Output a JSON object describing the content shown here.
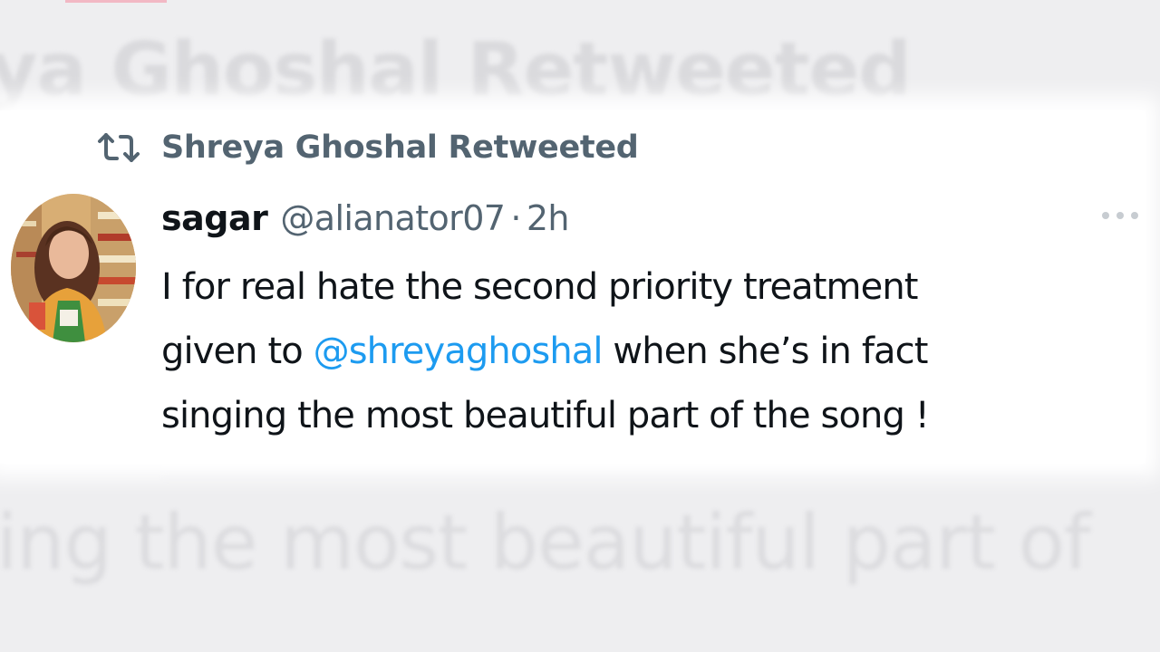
{
  "background_ghost": {
    "top_text": "ya Ghoshal Retweeted",
    "bottom_text": "ing the most beautiful part of"
  },
  "retweet": {
    "icon": "retweet-icon",
    "label": "Shreya Ghoshal Retweeted"
  },
  "tweet": {
    "avatar_icon": "avatar",
    "author_name": "sagar",
    "author_handle": "@alianator07",
    "separator": "·",
    "time": "2h",
    "more_icon": "more-options-icon",
    "body": {
      "line1": "I for real hate the second priority treatment",
      "line2_before": "given to ",
      "mention": "@shreyaghoshal",
      "line2_after": " when she’s in fact",
      "line3": "singing the most beautiful part of the song !"
    }
  },
  "colors": {
    "text_primary": "#0f1419",
    "text_secondary": "#536471",
    "mention": "#1d9bf0",
    "card_background": "#ffffff",
    "page_background": "#eeeef0"
  }
}
